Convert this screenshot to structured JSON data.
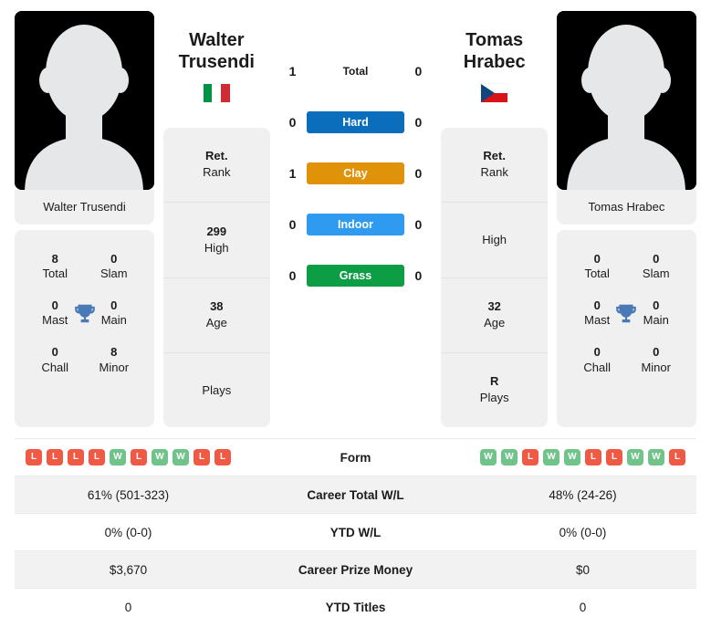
{
  "players": {
    "left": {
      "first_name": "Walter",
      "last_name": "Trusendi",
      "full_name": "Walter Trusendi",
      "flag": "italy-flag",
      "rank": "Ret.",
      "rank_label": "Rank",
      "high": "299",
      "high_label": "High",
      "age": "38",
      "age_label": "Age",
      "plays": "",
      "plays_label": "Plays",
      "titles": {
        "total": "8",
        "total_label": "Total",
        "slam": "0",
        "slam_label": "Slam",
        "mast": "0",
        "mast_label": "Mast",
        "main": "0",
        "main_label": "Main",
        "chall": "0",
        "chall_label": "Chall",
        "minor": "8",
        "minor_label": "Minor"
      },
      "form": [
        "L",
        "L",
        "L",
        "L",
        "W",
        "L",
        "W",
        "W",
        "L",
        "L"
      ],
      "career_wl": "61% (501-323)",
      "ytd_wl": "0% (0-0)",
      "prize_money": "$3,670",
      "ytd_titles": "0"
    },
    "right": {
      "first_name": "Tomas",
      "last_name": "Hrabec",
      "full_name": "Tomas Hrabec",
      "flag": "czech-republic-flag",
      "rank": "Ret.",
      "rank_label": "Rank",
      "high": "",
      "high_label": "High",
      "age": "32",
      "age_label": "Age",
      "plays": "R",
      "plays_label": "Plays",
      "titles": {
        "total": "0",
        "total_label": "Total",
        "slam": "0",
        "slam_label": "Slam",
        "mast": "0",
        "mast_label": "Mast",
        "main": "0",
        "main_label": "Main",
        "chall": "0",
        "chall_label": "Chall",
        "minor": "0",
        "minor_label": "Minor"
      },
      "form": [
        "W",
        "W",
        "L",
        "W",
        "W",
        "L",
        "L",
        "W",
        "W",
        "L"
      ],
      "career_wl": "48% (24-26)",
      "ytd_wl": "0% (0-0)",
      "prize_money": "$0",
      "ytd_titles": "0"
    }
  },
  "h2h": {
    "total": {
      "label": "Total",
      "left": "1",
      "right": "0"
    },
    "surfaces": [
      {
        "label": "Hard",
        "left": "0",
        "right": "0",
        "color": "#0a6ebd"
      },
      {
        "label": "Clay",
        "left": "1",
        "right": "0",
        "color": "#e09209"
      },
      {
        "label": "Indoor",
        "left": "0",
        "right": "0",
        "color": "#2e9bf0"
      },
      {
        "label": "Grass",
        "left": "0",
        "right": "0",
        "color": "#0d9e45"
      }
    ]
  },
  "stats_table": {
    "rows": [
      {
        "label": "Form",
        "type": "form"
      },
      {
        "label": "Career Total W/L",
        "type": "text",
        "left_key": "career_wl",
        "right_key": "career_wl"
      },
      {
        "label": "YTD W/L",
        "type": "text",
        "left_key": "ytd_wl",
        "right_key": "ytd_wl"
      },
      {
        "label": "Career Prize Money",
        "type": "text",
        "left_key": "prize_money",
        "right_key": "prize_money"
      },
      {
        "label": "YTD Titles",
        "type": "text",
        "left_key": "ytd_titles",
        "right_key": "ytd_titles"
      }
    ]
  },
  "colors": {
    "card_bg": "#f0f0f0",
    "win_badge": "#70c48a",
    "loss_badge": "#f05a45",
    "trophy": "#4a7ab5",
    "row_alt": "#f2f2f2"
  }
}
